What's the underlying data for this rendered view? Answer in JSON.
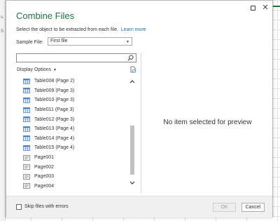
{
  "background": {
    "fragment_1": "s.",
    "fragment_2": "S"
  },
  "dialog": {
    "title": "Combine Files",
    "subtitle": "Select the object to be extracted from each file.",
    "learn_more": "Learn more",
    "sample_file_label": "Sample File:",
    "sample_file_value": "First file",
    "display_options": "Display Options",
    "preview_empty": "No item selected for preview",
    "skip_label": "Skip files with errors",
    "ok_label": "OK",
    "cancel_label": "Cancel",
    "accent_color": "#217346",
    "link_color": "#1d6fbf"
  },
  "nav_items": [
    {
      "label": "Table008 (Page 2)",
      "icon": "table-icon"
    },
    {
      "label": "Table009 (Page 3)",
      "icon": "table-icon"
    },
    {
      "label": "Table010 (Page 3)",
      "icon": "table-icon"
    },
    {
      "label": "Table011 (Page 3)",
      "icon": "table-icon"
    },
    {
      "label": "Table012 (Page 3)",
      "icon": "table-icon"
    },
    {
      "label": "Table013 (Page 4)",
      "icon": "table-icon"
    },
    {
      "label": "Table014 (Page 4)",
      "icon": "table-icon"
    },
    {
      "label": "Table015 (Page 4)",
      "icon": "table-icon"
    },
    {
      "label": "Page001",
      "icon": "page-icon"
    },
    {
      "label": "Page002",
      "icon": "page-icon"
    },
    {
      "label": "Page003",
      "icon": "page-icon"
    },
    {
      "label": "Page004",
      "icon": "page-icon"
    }
  ]
}
